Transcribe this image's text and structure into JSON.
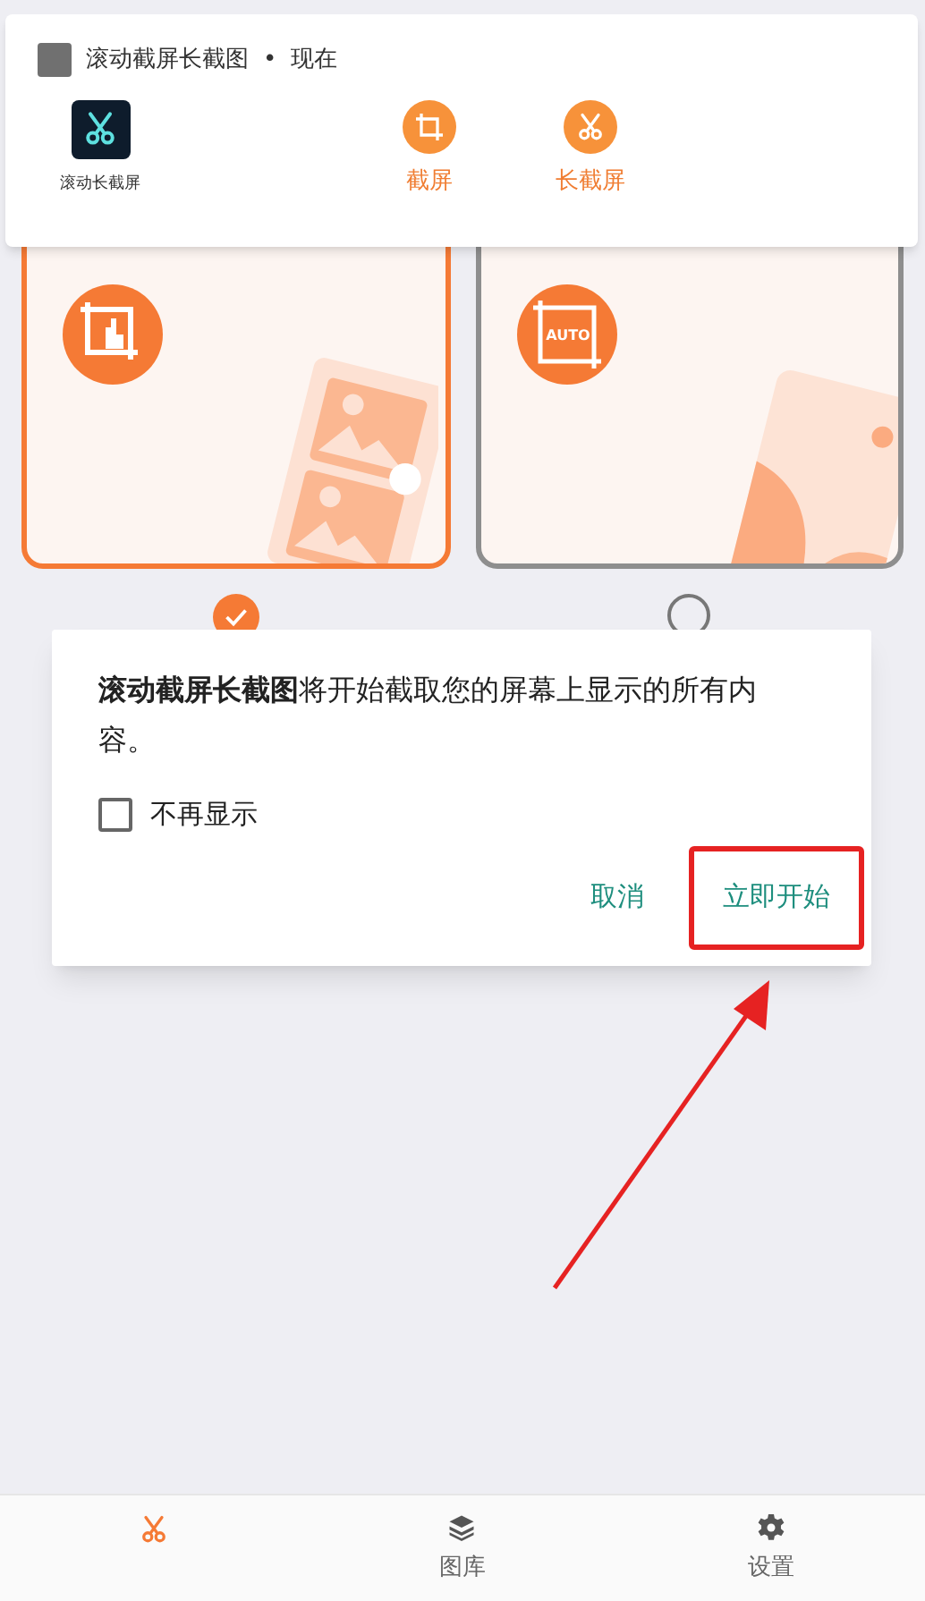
{
  "notification": {
    "app_name": "滚动截屏长截图",
    "separator": "•",
    "time": "现在",
    "app_icon_label": "滚动长截屏",
    "actions": [
      {
        "kind": "crop",
        "label": "截屏"
      },
      {
        "kind": "scissors",
        "label": "长截屏"
      }
    ]
  },
  "modes": [
    {
      "kind": "swipe",
      "selected": true
    },
    {
      "kind": "auto",
      "icon_text": "AUTO",
      "selected": false
    }
  ],
  "dialog": {
    "message": "**滚动截屏长截图**将开始截取您的屏幕上显示的所有内容。",
    "checkbox": {
      "label": "不再显示",
      "checked": false
    },
    "buttons": [
      {
        "label": "取消",
        "highlighted": false
      },
      {
        "label": "立即开始",
        "highlighted": true
      }
    ]
  },
  "bottom_nav": [
    {
      "kind": "scissors",
      "selected": true
    },
    {
      "kind": "layers",
      "label": "图库",
      "selected": false
    },
    {
      "kind": "gear",
      "label": "设置",
      "selected": false
    }
  ]
}
